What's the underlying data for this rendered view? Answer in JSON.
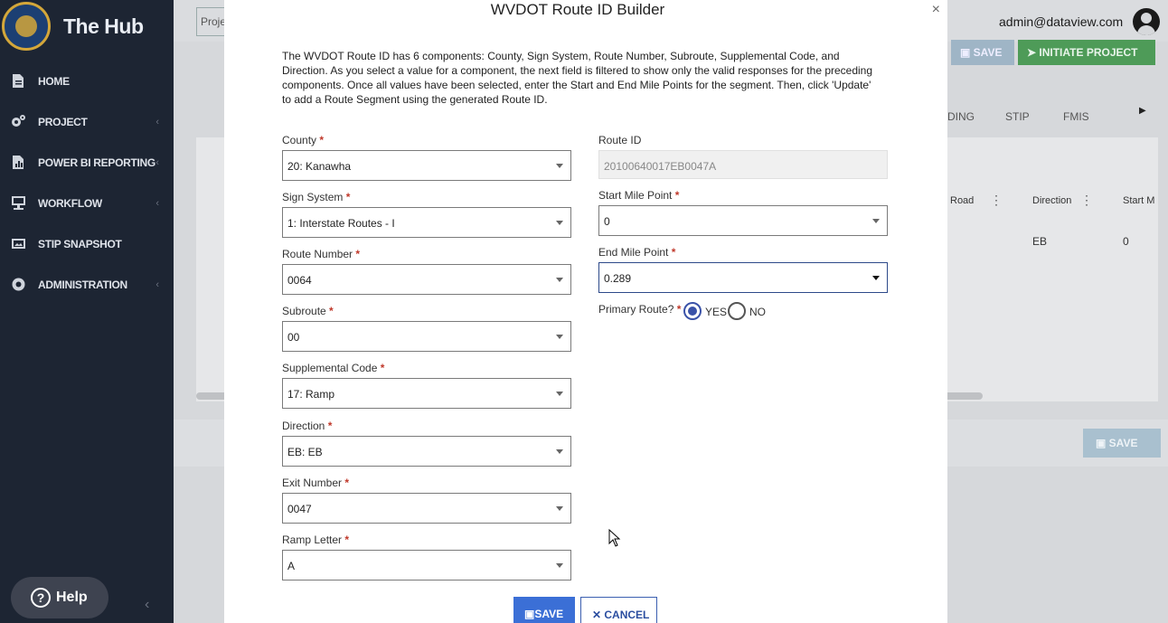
{
  "app": {
    "title": "The Hub",
    "user_email": "admin@dataview.com"
  },
  "sidebar": {
    "items": [
      {
        "label": "HOME",
        "icon": "document-icon",
        "has_submenu": false
      },
      {
        "label": "PROJECT",
        "icon": "gears-icon",
        "has_submenu": true
      },
      {
        "label": "POWER BI REPORTING",
        "icon": "report-icon",
        "has_submenu": true
      },
      {
        "label": "WORKFLOW",
        "icon": "workflow-icon",
        "has_submenu": true
      },
      {
        "label": "STIP SNAPSHOT",
        "icon": "snapshot-icon",
        "has_submenu": false
      },
      {
        "label": "ADMINISTRATION",
        "icon": "gear-icon",
        "has_submenu": true
      }
    ],
    "help_label": "Help"
  },
  "background": {
    "search_text": "Proje",
    "save_label": "SAVE",
    "initiate_label": "INITIATE PROJECT",
    "tabs": [
      "DING",
      "STIP",
      "FMIS"
    ],
    "columns": [
      "Road",
      "Direction",
      "Start M"
    ],
    "row": {
      "direction": "EB",
      "start": "0"
    },
    "footer_save_label": "SAVE"
  },
  "modal": {
    "title": "WVDOT Route ID Builder",
    "close": "×",
    "description": "The WVDOT Route ID has 6 components: County, Sign System, Route Number, Subroute, Supplemental Code, and Direction. As you select a value for a component, the next field is filtered to show only the valid responses for the preceding components. Once all values have been selected, enter the Start and End Mile Points for the segment. Then, click 'Update' to add a Route Segment using the generated Route ID.",
    "left_fields": [
      {
        "label": "County",
        "value": "20: Kanawha"
      },
      {
        "label": "Sign System",
        "value": "1: Interstate Routes - I"
      },
      {
        "label": "Route Number",
        "value": "0064"
      },
      {
        "label": "Subroute",
        "value": "00"
      },
      {
        "label": "Supplemental Code",
        "value": "17: Ramp"
      },
      {
        "label": "Direction",
        "value": "EB: EB"
      },
      {
        "label": "Exit Number",
        "value": "0047"
      },
      {
        "label": "Ramp Letter",
        "value": "A"
      }
    ],
    "route_id": {
      "label": "Route ID",
      "value": "20100640017EB0047A"
    },
    "start_mile": {
      "label": "Start Mile Point",
      "value": "0"
    },
    "end_mile": {
      "label": "End Mile Point",
      "value": "0.289"
    },
    "primary_route": {
      "label": "Primary Route?",
      "yes": "YES",
      "no": "NO",
      "selected": "YES"
    },
    "required_marker": "*",
    "save_label": "SAVE",
    "cancel_label": "CANCEL"
  }
}
